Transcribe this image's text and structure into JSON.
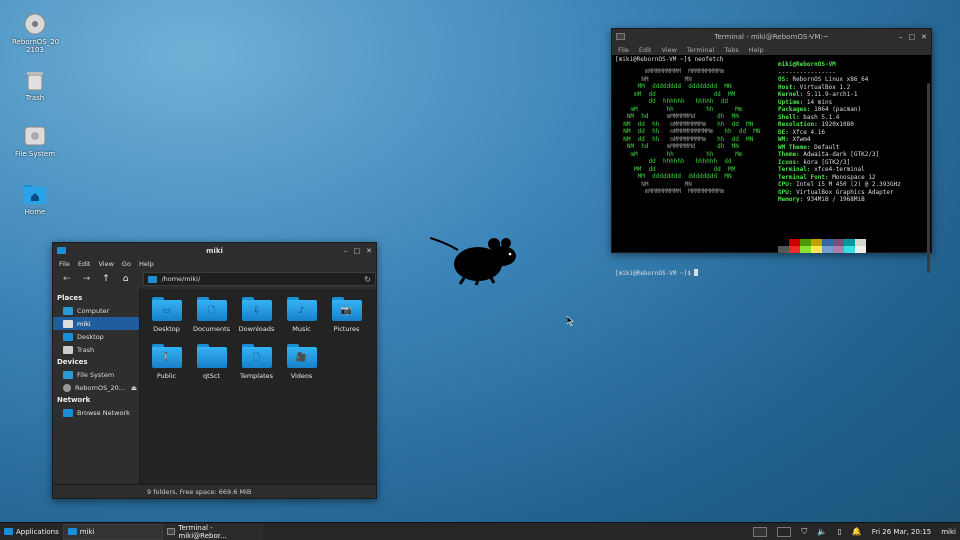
{
  "desktop": {
    "icons": [
      {
        "label": "RebornOS_20\n2103",
        "icon": "optical-disc-icon"
      },
      {
        "label": "Trash",
        "icon": "trash-icon"
      },
      {
        "label": "File System",
        "icon": "drive-icon"
      },
      {
        "label": "Home",
        "icon": "home-folder-icon"
      }
    ]
  },
  "file_manager": {
    "title": "miki",
    "menu": [
      "File",
      "Edit",
      "View",
      "Go",
      "Help"
    ],
    "path": "/home/miki/",
    "sidebar": {
      "places_header": "Places",
      "places": [
        "Computer",
        "miki",
        "Desktop",
        "Trash"
      ],
      "devices_header": "Devices",
      "devices": [
        "File System",
        "RebornOS_20..."
      ],
      "network_header": "Network",
      "network": [
        "Browse Network"
      ]
    },
    "files": [
      {
        "name": "Desktop",
        "glyph": "▭"
      },
      {
        "name": "Documents",
        "glyph": "🗋"
      },
      {
        "name": "Downloads",
        "glyph": "⇩"
      },
      {
        "name": "Music",
        "glyph": "♪"
      },
      {
        "name": "Pictures",
        "glyph": "📷"
      },
      {
        "name": "Public",
        "glyph": "🚶"
      },
      {
        "name": "qtSct",
        "glyph": ""
      },
      {
        "name": "Templates",
        "glyph": "🗋"
      },
      {
        "name": "Videos",
        "glyph": "🎥"
      }
    ],
    "status": "9 folders, Free space: 669.6 MiB"
  },
  "terminal": {
    "title": "Terminal - miki@RebornOS-VM:~",
    "menu": [
      "File",
      "Edit",
      "View",
      "Terminal",
      "Tabs",
      "Help"
    ],
    "prompt1": "[miki@RebornOS-VM ~]$ neofetch",
    "userhost": "miki@RebornOS-VM",
    "separator": "----------------",
    "info": [
      {
        "k": "OS",
        "v": "RebornOS Linux x86_64"
      },
      {
        "k": "Host",
        "v": "VirtualBox 1.2"
      },
      {
        "k": "Kernel",
        "v": "5.11.9-arch1-1"
      },
      {
        "k": "Uptime",
        "v": "14 mins"
      },
      {
        "k": "Packages",
        "v": "1064 (pacman)"
      },
      {
        "k": "Shell",
        "v": "bash 5.1.4"
      },
      {
        "k": "Resolution",
        "v": "1920x1080"
      },
      {
        "k": "DE",
        "v": "Xfce 4.16"
      },
      {
        "k": "WM",
        "v": "Xfwm4"
      },
      {
        "k": "WM Theme",
        "v": "Default"
      },
      {
        "k": "Theme",
        "v": "Adwaita-dark [GTK2/3]"
      },
      {
        "k": "Icons",
        "v": "kora [GTK2/3]"
      },
      {
        "k": "Terminal",
        "v": "xfce4-terminal"
      },
      {
        "k": "Terminal Font",
        "v": "Monospace 12"
      },
      {
        "k": "CPU",
        "v": "Intel i5 M 450 (2) @ 2.393GHz"
      },
      {
        "k": "GPU",
        "v": "VirtualBox Graphics Adapter"
      },
      {
        "k": "Memory",
        "v": "934MiB / 1968MiB"
      }
    ],
    "palette_row1": [
      "#000000",
      "#cc0000",
      "#4e9a06",
      "#c4a000",
      "#3465a4",
      "#75507b",
      "#06989a",
      "#d3d7cf"
    ],
    "palette_row2": [
      "#555753",
      "#ef2929",
      "#8ae234",
      "#fce94f",
      "#729fcf",
      "#ad7fa8",
      "#34e2e2",
      "#eeeeec"
    ],
    "prompt2": "[miki@RebornOS-VM ~]$ "
  },
  "taskbar": {
    "applications": "Applications",
    "windows": [
      "miki",
      "Terminal - miki@Rebor..."
    ],
    "clock": "Fri 26 Mar, 20:15",
    "user": "miki"
  }
}
